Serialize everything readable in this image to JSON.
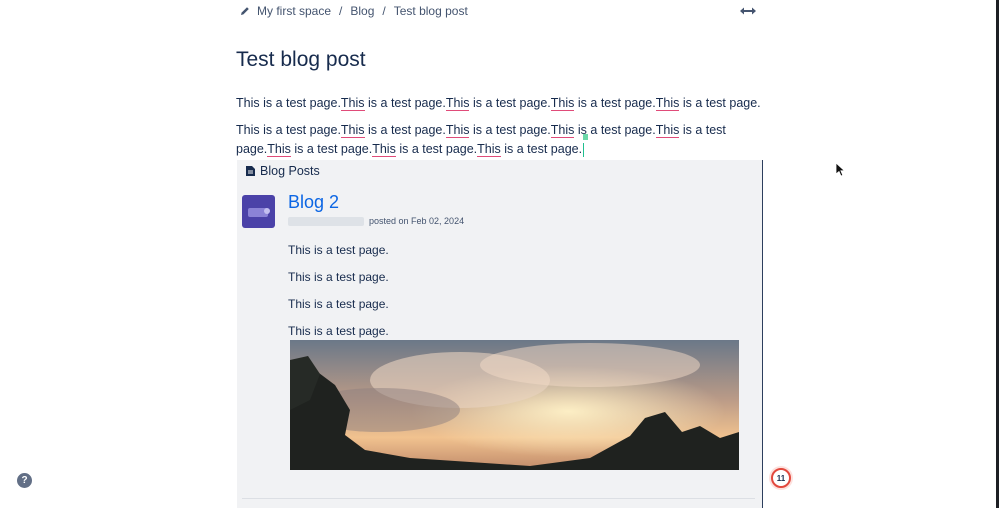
{
  "breadcrumbs": {
    "space_icon": "pencil-icon",
    "space": "My first space",
    "section": "Blog",
    "page": "Test blog post",
    "separator": "/"
  },
  "header": {
    "width_toggle_icon": "expand-width-icon"
  },
  "page": {
    "title": "Test blog post",
    "paragraph1": [
      {
        "t": "This is a test page.",
        "sq": false
      },
      {
        "t": "This",
        "sq": true
      },
      {
        "t": " is a test page.",
        "sq": false
      },
      {
        "t": "This",
        "sq": true
      },
      {
        "t": " is a test page.",
        "sq": false
      },
      {
        "t": "This",
        "sq": true
      },
      {
        "t": " is a test page.",
        "sq": false
      },
      {
        "t": "This",
        "sq": true
      },
      {
        "t": " is a test page.",
        "sq": false
      }
    ],
    "paragraph2": [
      {
        "t": "This is a test page.",
        "sq": false
      },
      {
        "t": "This",
        "sq": true
      },
      {
        "t": " is a test page.",
        "sq": false
      },
      {
        "t": "This",
        "sq": true
      },
      {
        "t": " is a test page.",
        "sq": false
      },
      {
        "t": "This",
        "sq": true
      },
      {
        "t": " is a test page.",
        "sq": false
      },
      {
        "t": "This",
        "sq": true
      },
      {
        "t": " is a test page.",
        "sq": false
      },
      {
        "t": "This",
        "sq": true
      },
      {
        "t": " is a test page.",
        "sq": false
      },
      {
        "t": "This",
        "sq": true
      },
      {
        "t": " is a test page.",
        "sq": false
      },
      {
        "t": "This",
        "sq": true
      },
      {
        "t": " is a test page.",
        "sq": false
      }
    ]
  },
  "blog_posts": {
    "header_icon": "document-icon",
    "header": "Blog Posts",
    "post": {
      "title": "Blog 2",
      "posted_on": "posted on Feb 02, 2024",
      "lines": [
        "This is a test page.",
        "This is a test page.",
        "This is a test page.",
        "This is a test page."
      ]
    }
  },
  "help": {
    "icon": "help-icon",
    "label": "?"
  },
  "notifications": {
    "count": "11"
  },
  "colors": {
    "link": "#0c66e4",
    "text": "#172b4d",
    "spell_underline": "#e04b79",
    "badge_ring": "#e2483d"
  }
}
